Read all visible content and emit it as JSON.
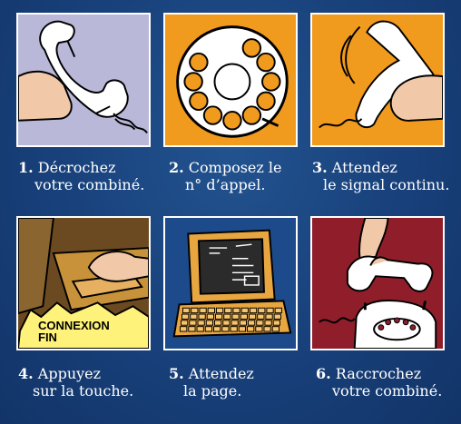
{
  "steps": [
    {
      "number": "1.",
      "line1": "Décrochez",
      "line2": "votre combiné."
    },
    {
      "number": "2.",
      "line1": "Composez le",
      "line2": "n° d’appel."
    },
    {
      "number": "3.",
      "line1": "Attendez",
      "line2": "le signal continu."
    },
    {
      "number": "4.",
      "line1": "Appuyez",
      "line2": "sur la touche."
    },
    {
      "number": "5.",
      "line1": "Attendez",
      "line2": "la page."
    },
    {
      "number": "6.",
      "line1": "Raccrochez",
      "line2": "votre combiné."
    }
  ],
  "key_label": {
    "line1": "CONNEXION",
    "line2": "FIN"
  },
  "colors": {
    "background": "#18407a",
    "panel_1": "#b9b8d9",
    "panel_2": "#f09a1e",
    "panel_3": "#f09a1e",
    "panel_4": "#6b4a22",
    "panel_5": "#1d4a8a",
    "panel_6": "#8f1e2a",
    "label_yellow": "#fff27a"
  },
  "icons": [
    "phone-handset-icon",
    "rotary-dial-icon",
    "ringing-handset-icon",
    "connexion-key-icon",
    "minitel-terminal-icon",
    "telephone-base-icon"
  ]
}
